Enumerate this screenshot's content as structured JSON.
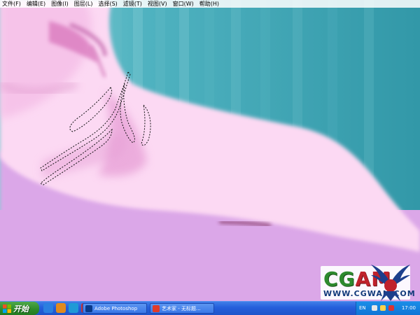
{
  "menubar": {
    "items": [
      {
        "label": "文件(F)"
      },
      {
        "label": "编辑(E)"
      },
      {
        "label": "图像(I)"
      },
      {
        "label": "图层(L)"
      },
      {
        "label": "选择(S)"
      },
      {
        "label": "滤镜(T)"
      },
      {
        "label": "视图(V)"
      },
      {
        "label": "窗口(W)"
      },
      {
        "label": "帮助(H)"
      }
    ]
  },
  "watermark": {
    "letters_green": "CG",
    "letters_red": "AM",
    "url": "WWW.CGWAN.COM"
  },
  "taskbar": {
    "start_label": "开始",
    "quick_launch": [
      {
        "icon": "internet-explorer-icon",
        "color": "#2c7fe0"
      },
      {
        "icon": "media-player-icon",
        "color": "#e08a1f"
      },
      {
        "icon": "browser-icon",
        "color": "#1f9ad6"
      },
      {
        "icon": "show-desktop-icon",
        "color": "#c33"
      }
    ],
    "windows": [
      {
        "label": "Adobe Photoshop",
        "icon": "photoshop-icon",
        "icon_color": "#0a3a8a"
      },
      {
        "label": "艺术家 - 无标题...",
        "icon": "painter-icon",
        "icon_color": "#e03b2b"
      }
    ],
    "tray": {
      "language": "EN",
      "clock": "17:00"
    }
  },
  "colors": {
    "background_teal": "#3fa4b4",
    "skin_pink": "#fcd9f3",
    "lower_purple": "#dba7e8",
    "taskbar_blue": "#245edb",
    "start_green": "#2c8a29"
  }
}
